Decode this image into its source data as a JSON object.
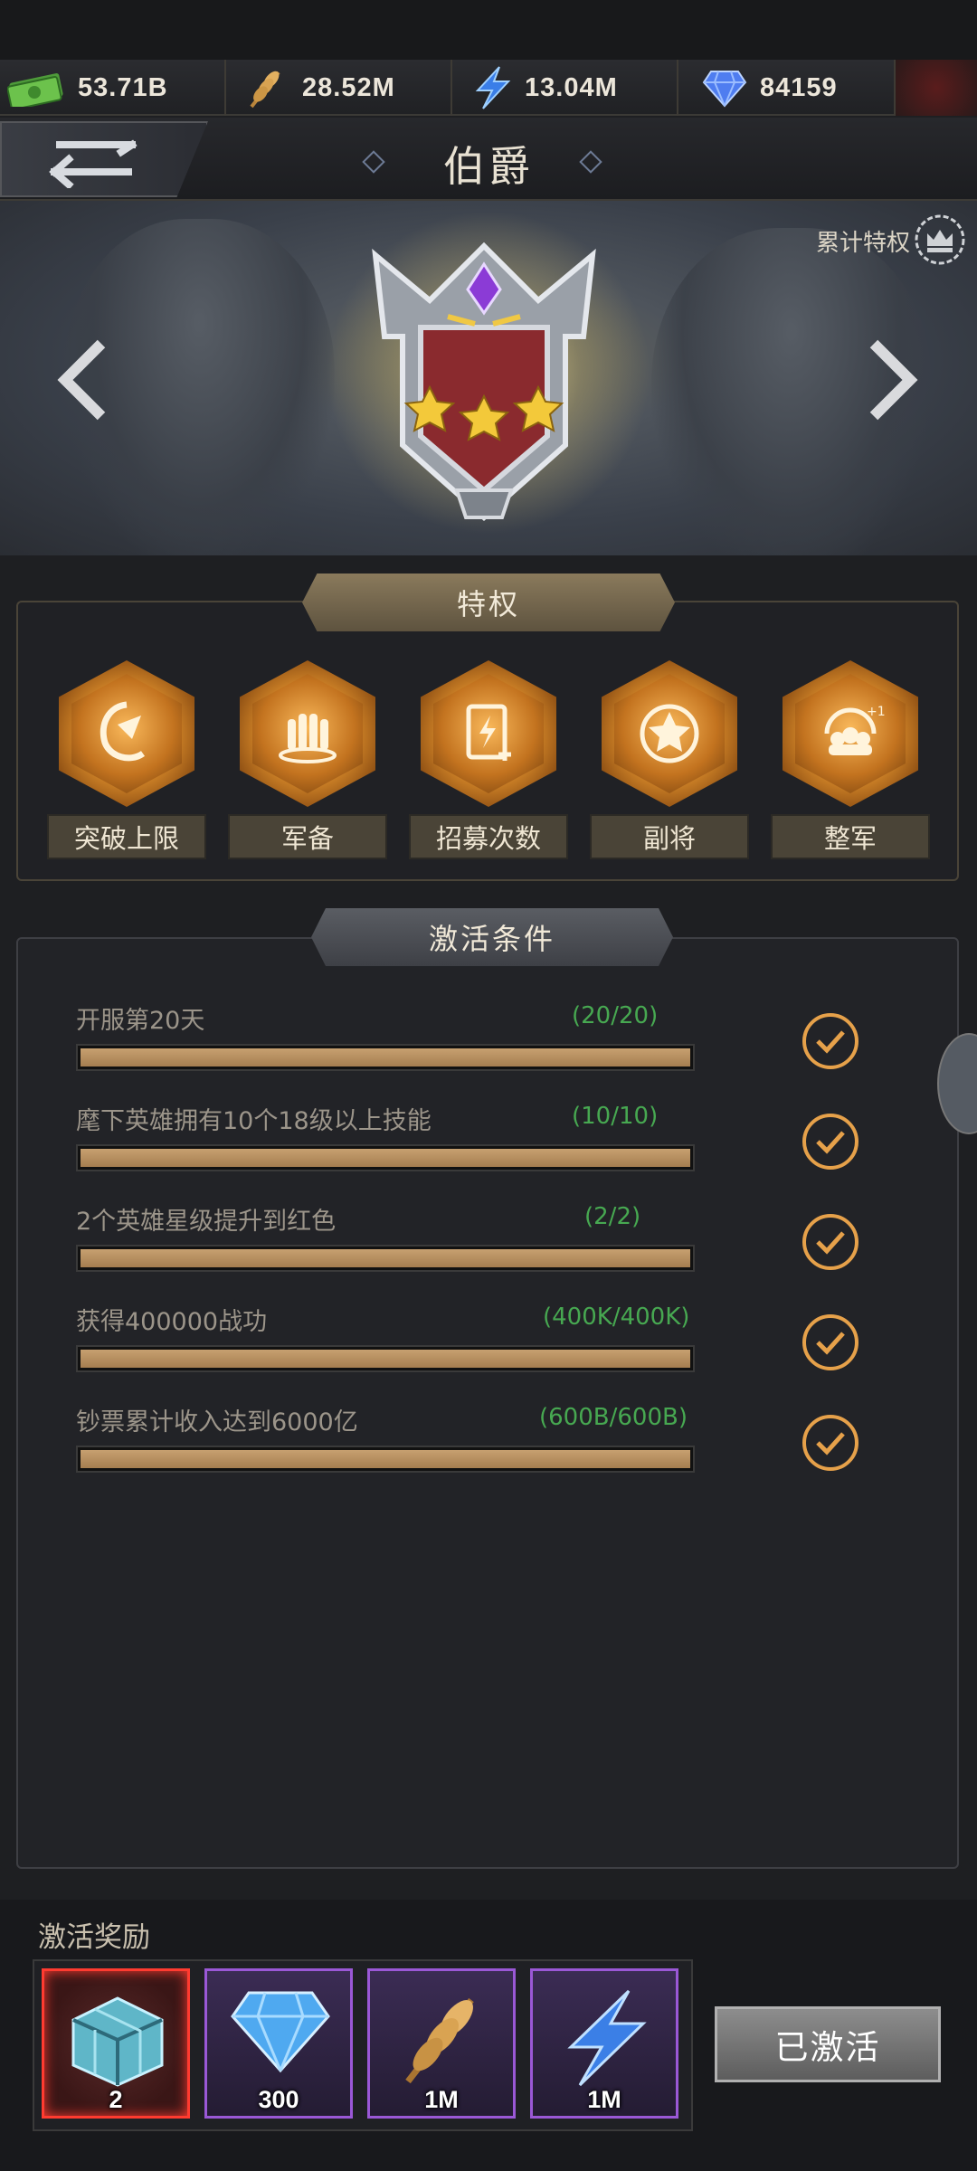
{
  "resources": [
    {
      "icon": "cash-icon",
      "value": "53.71B"
    },
    {
      "icon": "wheat-icon",
      "value": "28.52M"
    },
    {
      "icon": "lightning-icon",
      "value": "13.04M"
    },
    {
      "icon": "diamond-icon",
      "value": "84159"
    }
  ],
  "header": {
    "title": "伯爵"
  },
  "banner": {
    "cumulative_label": "累计特权"
  },
  "privileges": {
    "title": "特权",
    "items": [
      {
        "label": "突破上限",
        "icon": "breakthrough-icon"
      },
      {
        "label": "军备",
        "icon": "armament-icon"
      },
      {
        "label": "招募次数",
        "icon": "recruit-card-icon"
      },
      {
        "label": "副将",
        "icon": "star-emblem-icon"
      },
      {
        "label": "整军",
        "icon": "troops-icon"
      }
    ]
  },
  "conditions": {
    "title": "激活条件",
    "items": [
      {
        "text": "开服第20天",
        "progress": "(20/20)",
        "fill": 1.0
      },
      {
        "text": "麾下英雄拥有10个18级以上技能",
        "progress": "(10/10)",
        "fill": 1.0
      },
      {
        "text": "2个英雄星级提升到红色",
        "progress": "(2/2)",
        "fill": 1.0
      },
      {
        "text": "获得400000战功",
        "progress": "(400K/400K)",
        "fill": 1.0
      },
      {
        "text": "钞票累计收入达到6000亿",
        "progress": "(600B/600B)",
        "fill": 1.0
      }
    ]
  },
  "rewards": {
    "title": "激活奖励",
    "items": [
      {
        "icon": "crate-icon",
        "qty": "2",
        "rarity": "red"
      },
      {
        "icon": "diamond-icon",
        "qty": "300",
        "rarity": "purple"
      },
      {
        "icon": "wheat-icon",
        "qty": "1M",
        "rarity": "purple"
      },
      {
        "icon": "lightning-icon",
        "qty": "1M",
        "rarity": "purple"
      }
    ],
    "activate_label": "已激活"
  },
  "colors": {
    "accent_gold": "#e6a14a",
    "progress_green": "#47a851",
    "bar_fill": "#b68d5e"
  }
}
